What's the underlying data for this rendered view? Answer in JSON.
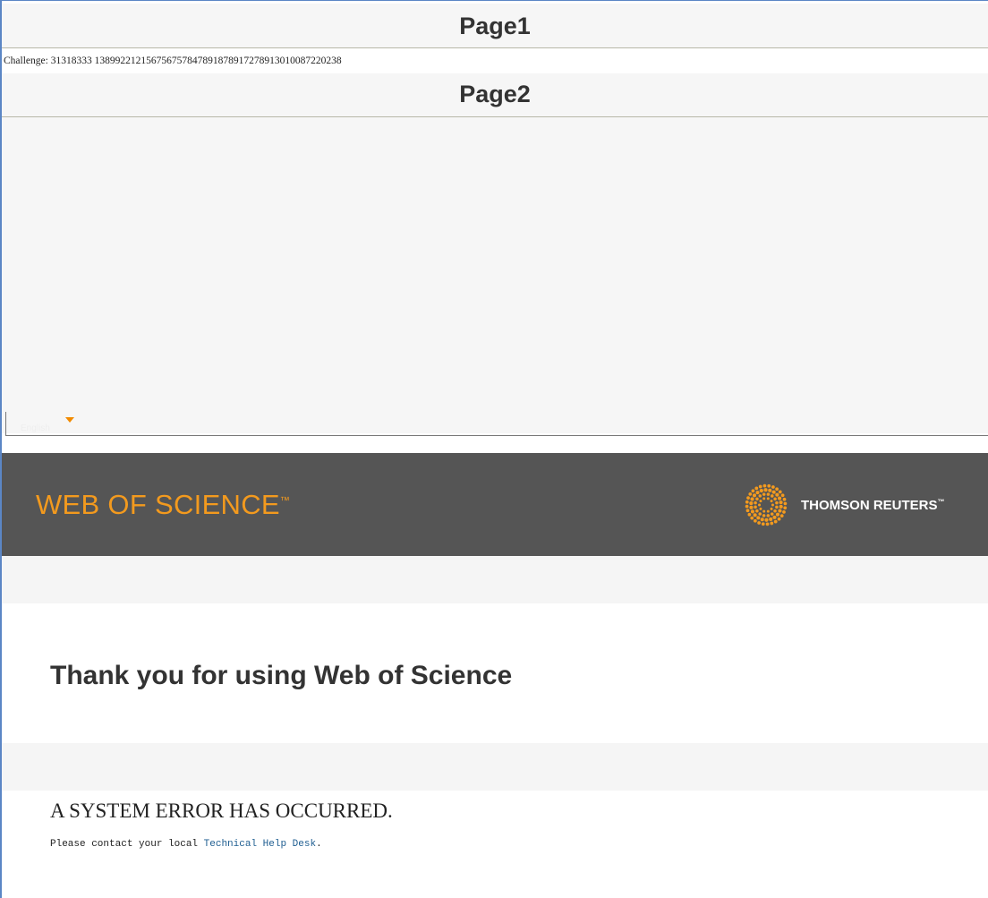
{
  "page1_heading": "Page1",
  "challenge_text": "Challenge: 31318333 13899221215675675784789187891727891301008722023​8",
  "page2_heading": "Page2",
  "language_selector": {
    "label": "English"
  },
  "header": {
    "product_name": "WEB OF SCIENCE",
    "product_tm": "™",
    "company_name": "THOMSON REUTERS",
    "company_tm": "™",
    "accent_color": "#f39a1e",
    "background_color": "#555555"
  },
  "main": {
    "thank_you": "Thank you for using Web of Science",
    "error_title": "A SYSTEM ERROR HAS OCCURRED.",
    "contact_prefix": "Please contact your local ",
    "contact_link": "Technical Help Desk",
    "contact_suffix": "."
  }
}
